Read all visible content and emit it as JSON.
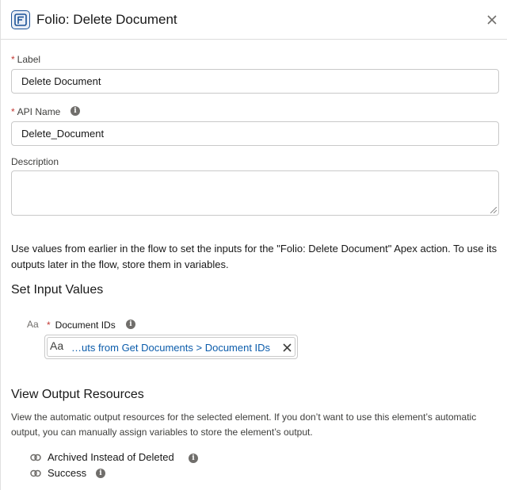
{
  "header": {
    "title": "Folio: Delete Document",
    "icon": "flow-action-icon",
    "close_icon": "close-icon"
  },
  "form": {
    "label_field": {
      "label": "Label",
      "required_marker": "*",
      "value": "Delete Document"
    },
    "api_name_field": {
      "label": "API Name",
      "required_marker": "*",
      "value": "Delete_Document"
    },
    "description_field": {
      "label": "Description",
      "value": ""
    }
  },
  "intro_text": "Use values from earlier in the flow to set the inputs for the \"Folio: Delete Document\" Apex action. To use its outputs later in the flow, store them in variables.",
  "inputs_section": {
    "title": "Set Input Values",
    "document_ids": {
      "type_glyph": "Aa",
      "required_marker": "*",
      "label": "Document IDs",
      "pill_text": "…uts from Get Documents > Document IDs"
    }
  },
  "outputs_section": {
    "title": "View Output Resources",
    "description": "View the automatic output resources for the selected element. If you don’t want to use this element’s automatic output, you can manually assign variables to store the element’s output.",
    "items": [
      {
        "label": "Archived Instead of Deleted"
      },
      {
        "label": "Success"
      }
    ]
  },
  "colors": {
    "accent_blue": "#0b5cab",
    "required_red": "#c23934",
    "border": "#c9c9c9"
  }
}
